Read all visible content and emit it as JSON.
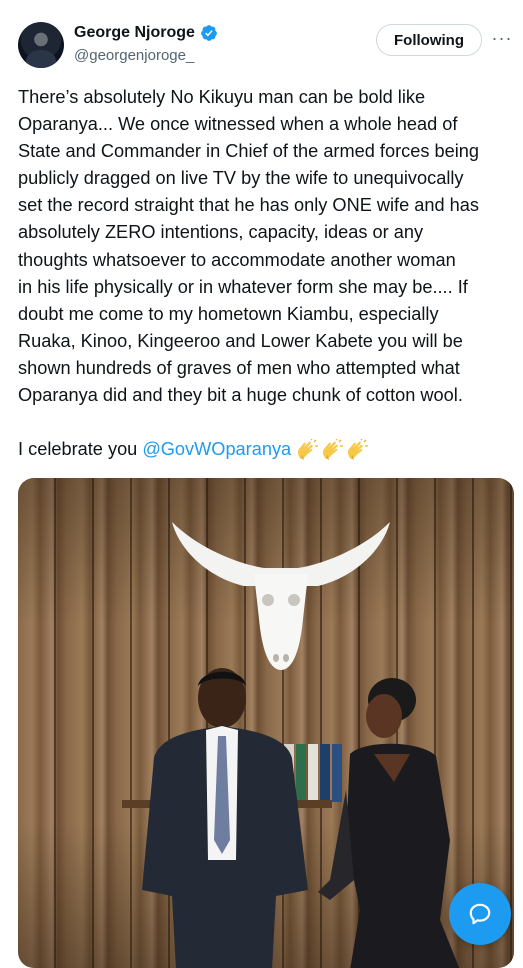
{
  "author": {
    "name": "George Njoroge",
    "handle": "@georgenjoroge_",
    "verified": true
  },
  "follow_button": {
    "label": "Following"
  },
  "more_menu": {
    "icon": "more-horizontal-icon"
  },
  "tweet": {
    "text": "There’s absolutely No Kikuyu man can be bold like\nOparanya... We once witnessed when a whole head of\nState and Commander in Chief of the armed forces being\npublicly dragged on live TV by the wife to unequivocally\nset the record straight that he has only ONE wife and has\nabsolutely ZERO intentions, capacity, ideas or any\nthoughts whatsoever to accommodate another woman\nin his life physically or in whatever form she may be.... If\ndoubt me come to my hometown Kiambu, especially\nRuaka, Kinoo, Kingeeroo and Lower Kabete you will be\nshown hundreds of graves of men who attempted what\nOparanya did and they bit a huge chunk of cotton wool.",
    "celebrate_prefix": "I celebrate you",
    "mention": "@GovWOparanya",
    "emoji_icons": [
      "clapping-hands-icon",
      "clapping-hands-icon",
      "clapping-hands-icon"
    ]
  },
  "photo": {
    "subject": "couple-photo"
  },
  "colors": {
    "accent": "#1d9bf0",
    "text": "#0f1419",
    "secondary": "#536471"
  },
  "fab": {
    "icon": "chat-bubble-icon"
  }
}
